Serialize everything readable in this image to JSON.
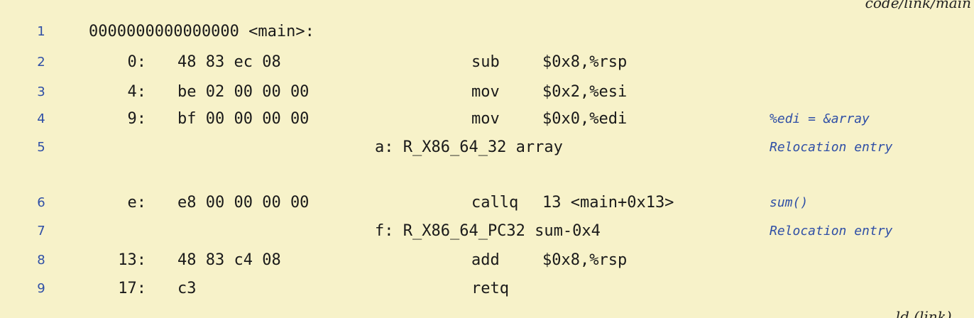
{
  "page": {
    "top_right_text": "code/link/main",
    "bottom_right_text": "ld (link) ..."
  },
  "listing": {
    "rows": [
      {
        "ln": "1",
        "head": "0000000000000000 <main>:"
      },
      {
        "ln": "2",
        "addr": "0:",
        "bytes": "48 83 ec 08",
        "mn": "sub",
        "ops": "$0x8,%rsp"
      },
      {
        "ln": "3",
        "addr": "4:",
        "bytes": "be 02 00 00 00",
        "mn": "mov",
        "ops": "$0x2,%esi"
      },
      {
        "ln": "4",
        "addr": "9:",
        "bytes": "bf 00 00 00 00",
        "mn": "mov",
        "ops": "$0x0,%edi",
        "cm": "%edi = &array"
      },
      {
        "ln": "5",
        "reloc": "a: R_X86_64_32 array",
        "cm": "Relocation entry"
      },
      {
        "ln": "6",
        "addr": "e:",
        "bytes": "e8 00 00 00 00",
        "mn": "callq",
        "ops": "13 <main+0x13>",
        "cm": "sum()"
      },
      {
        "ln": "7",
        "reloc": "f: R_X86_64_PC32 sum-0x4",
        "cm": "Relocation entry"
      },
      {
        "ln": "8",
        "addr": "13:",
        "bytes": "48 83 c4 08",
        "mn": "add",
        "ops": "$0x8,%rsp"
      },
      {
        "ln": "9",
        "addr": "17:",
        "bytes": "c3",
        "mn": "retq"
      }
    ]
  }
}
